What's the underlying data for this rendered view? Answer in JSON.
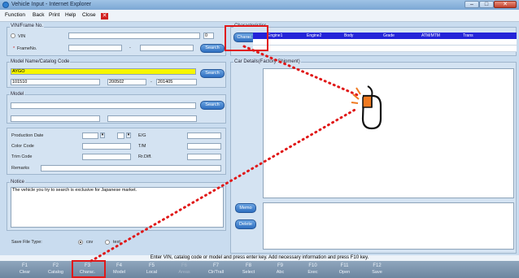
{
  "window": {
    "title": "Vehicle Input - Internet Explorer"
  },
  "menu": {
    "items": [
      "Function",
      "Back",
      "Print",
      "Help",
      "Close"
    ]
  },
  "vin_frame": {
    "legend": "VIN/Frame No.",
    "vin_label": "VIN",
    "vin_value": "",
    "vin_count": "0",
    "frame_label": "FrameNo.",
    "frame_mark": "*",
    "frame_dash": "-",
    "search_label": "Search"
  },
  "characteristics": {
    "legend": "Characteristics",
    "button_label": "Charac.",
    "columns": [
      "Engine1",
      "Engine2",
      "Body",
      "Grade",
      "ATM/MTM",
      "Trans"
    ]
  },
  "model_catalog": {
    "legend": "Model Name/Catalog Code",
    "model_name": "AYGO",
    "catalog_code": "101510",
    "date_from": "200502",
    "date_to": "201405",
    "dash": "-",
    "search_label": "Search"
  },
  "model": {
    "legend": "Model",
    "search_label": "Search"
  },
  "details": {
    "production_date_label": "Production Date",
    "eg_label": "E/G",
    "color_code_label": "Color Code",
    "tm_label": "T/M",
    "trim_code_label": "Trim Code",
    "rrdiff_label": "Rr.Diff.",
    "remarks_label": "Remarks"
  },
  "notice": {
    "legend": "Notice",
    "text": "The vehicle you try to search is exclusive for Japanese market."
  },
  "car_details": {
    "legend": "Car Details(Factory Shipment)"
  },
  "side_buttons": {
    "memo_label": "Memo",
    "delete_label": "Delete"
  },
  "save": {
    "label": "Save File Type:",
    "options": [
      "csv",
      "text"
    ],
    "selected": "csv"
  },
  "status": {
    "message": "Enter VIN, catalog code or model and press enter key. Add necessary information and press F10 key."
  },
  "fkeys": [
    {
      "key": "F1",
      "label": "Clear",
      "enabled": true
    },
    {
      "key": "F2",
      "label": "Catalog",
      "enabled": true
    },
    {
      "key": "F3",
      "label": "Charac.",
      "enabled": true
    },
    {
      "key": "F4",
      "label": "Model",
      "enabled": true
    },
    {
      "key": "F5",
      "label": "Local",
      "enabled": true
    },
    {
      "key": "F6",
      "label": "Areas",
      "enabled": false
    },
    {
      "key": "F7",
      "label": "Clr/Trall",
      "enabled": true
    },
    {
      "key": "F8",
      "label": "Select",
      "enabled": true
    },
    {
      "key": "F9",
      "label": "Abc",
      "enabled": true
    },
    {
      "key": "F10",
      "label": "Exec",
      "enabled": true
    },
    {
      "key": "F11",
      "label": "Open",
      "enabled": true
    },
    {
      "key": "F12",
      "label": "Save",
      "enabled": true
    }
  ],
  "colors": {
    "highlight": "#e01818",
    "accent_button": "#2f6fc0",
    "model_name_bg": "#f6f600",
    "table_header": "#2424d8",
    "click_pointer": "#f07a20"
  }
}
